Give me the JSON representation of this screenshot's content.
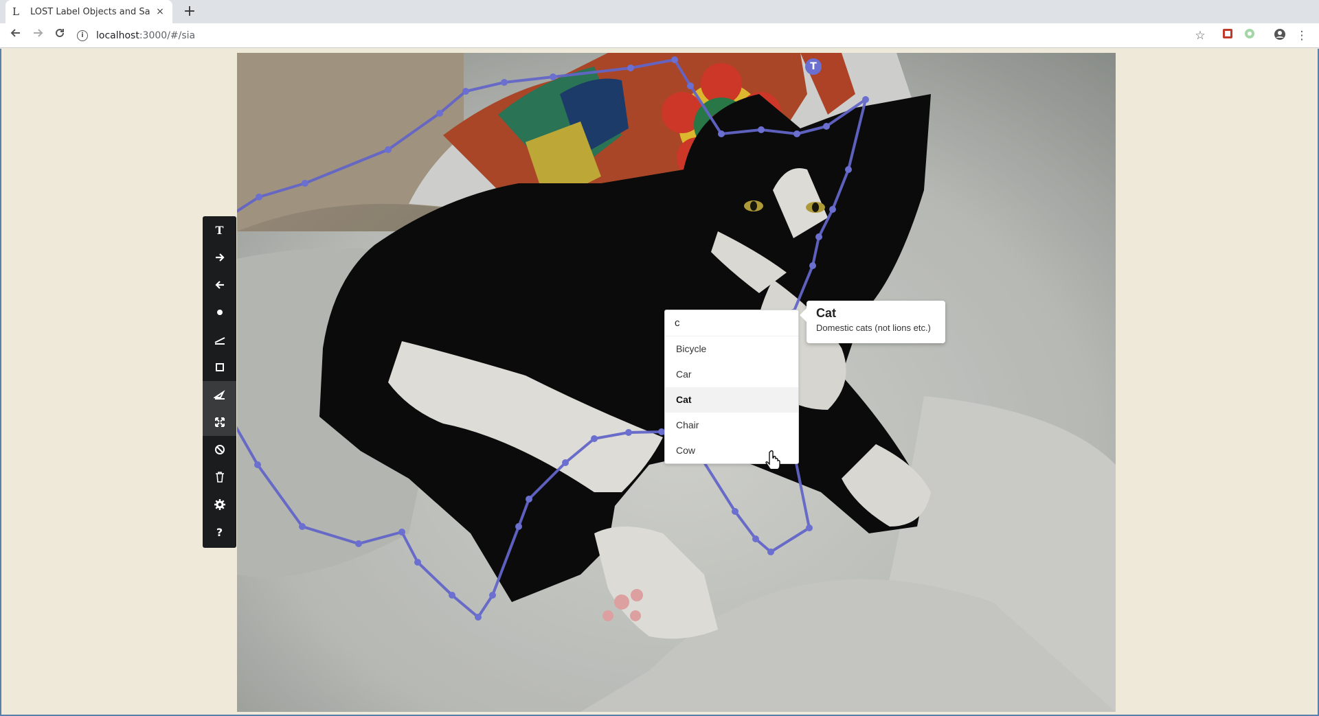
{
  "browser": {
    "tab_title": "LOST Label Objects and Sa",
    "tab_close": "×",
    "new_tab": "+",
    "url_host": "localhost",
    "url_rest": ":3000/#/sia",
    "back_icon": "arrow-left-icon",
    "forward_icon": "arrow-right-icon",
    "reload_icon": "reload-icon",
    "bookmark_icon": "star-icon",
    "account_icon": "account-icon",
    "menu_icon": "kebab-menu-icon"
  },
  "toolbar": {
    "tools": [
      {
        "name": "tool-text",
        "icon": "T"
      },
      {
        "name": "tool-next-image",
        "icon": "→"
      },
      {
        "name": "tool-prev-image",
        "icon": "←"
      },
      {
        "name": "tool-point",
        "icon": "●"
      },
      {
        "name": "tool-line",
        "icon": "line"
      },
      {
        "name": "tool-bbox",
        "icon": "□"
      },
      {
        "name": "tool-polygon",
        "icon": "polygon",
        "active": true
      },
      {
        "name": "tool-fullscreen",
        "icon": "expand",
        "active": true
      },
      {
        "name": "tool-junk",
        "icon": "⊘"
      },
      {
        "name": "tool-delete",
        "icon": "trash"
      },
      {
        "name": "tool-settings",
        "icon": "gear"
      },
      {
        "name": "tool-help",
        "icon": "?"
      }
    ]
  },
  "annotation": {
    "badge": "T",
    "color": "#6a6fd0"
  },
  "label_select": {
    "search_value": "c",
    "options": [
      "Bicycle",
      "Car",
      "Cat",
      "Chair",
      "Cow"
    ],
    "hovered": "Cat"
  },
  "label_info": {
    "title": "Cat",
    "description": "Domestic cats (not lions etc.)"
  }
}
